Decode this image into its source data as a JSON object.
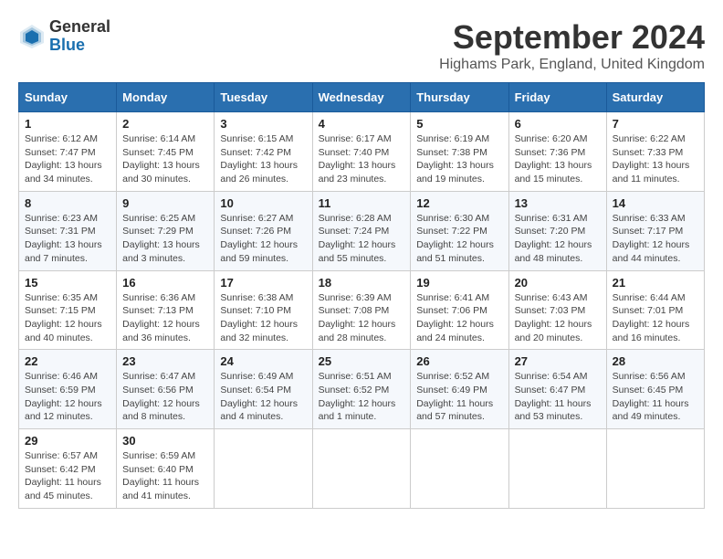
{
  "header": {
    "logo_general": "General",
    "logo_blue": "Blue",
    "month_year": "September 2024",
    "location": "Highams Park, England, United Kingdom"
  },
  "days_of_week": [
    "Sunday",
    "Monday",
    "Tuesday",
    "Wednesday",
    "Thursday",
    "Friday",
    "Saturday"
  ],
  "weeks": [
    [
      {
        "day": "1",
        "info": "Sunrise: 6:12 AM\nSunset: 7:47 PM\nDaylight: 13 hours\nand 34 minutes."
      },
      {
        "day": "2",
        "info": "Sunrise: 6:14 AM\nSunset: 7:45 PM\nDaylight: 13 hours\nand 30 minutes."
      },
      {
        "day": "3",
        "info": "Sunrise: 6:15 AM\nSunset: 7:42 PM\nDaylight: 13 hours\nand 26 minutes."
      },
      {
        "day": "4",
        "info": "Sunrise: 6:17 AM\nSunset: 7:40 PM\nDaylight: 13 hours\nand 23 minutes."
      },
      {
        "day": "5",
        "info": "Sunrise: 6:19 AM\nSunset: 7:38 PM\nDaylight: 13 hours\nand 19 minutes."
      },
      {
        "day": "6",
        "info": "Sunrise: 6:20 AM\nSunset: 7:36 PM\nDaylight: 13 hours\nand 15 minutes."
      },
      {
        "day": "7",
        "info": "Sunrise: 6:22 AM\nSunset: 7:33 PM\nDaylight: 13 hours\nand 11 minutes."
      }
    ],
    [
      {
        "day": "8",
        "info": "Sunrise: 6:23 AM\nSunset: 7:31 PM\nDaylight: 13 hours\nand 7 minutes."
      },
      {
        "day": "9",
        "info": "Sunrise: 6:25 AM\nSunset: 7:29 PM\nDaylight: 13 hours\nand 3 minutes."
      },
      {
        "day": "10",
        "info": "Sunrise: 6:27 AM\nSunset: 7:26 PM\nDaylight: 12 hours\nand 59 minutes."
      },
      {
        "day": "11",
        "info": "Sunrise: 6:28 AM\nSunset: 7:24 PM\nDaylight: 12 hours\nand 55 minutes."
      },
      {
        "day": "12",
        "info": "Sunrise: 6:30 AM\nSunset: 7:22 PM\nDaylight: 12 hours\nand 51 minutes."
      },
      {
        "day": "13",
        "info": "Sunrise: 6:31 AM\nSunset: 7:20 PM\nDaylight: 12 hours\nand 48 minutes."
      },
      {
        "day": "14",
        "info": "Sunrise: 6:33 AM\nSunset: 7:17 PM\nDaylight: 12 hours\nand 44 minutes."
      }
    ],
    [
      {
        "day": "15",
        "info": "Sunrise: 6:35 AM\nSunset: 7:15 PM\nDaylight: 12 hours\nand 40 minutes."
      },
      {
        "day": "16",
        "info": "Sunrise: 6:36 AM\nSunset: 7:13 PM\nDaylight: 12 hours\nand 36 minutes."
      },
      {
        "day": "17",
        "info": "Sunrise: 6:38 AM\nSunset: 7:10 PM\nDaylight: 12 hours\nand 32 minutes."
      },
      {
        "day": "18",
        "info": "Sunrise: 6:39 AM\nSunset: 7:08 PM\nDaylight: 12 hours\nand 28 minutes."
      },
      {
        "day": "19",
        "info": "Sunrise: 6:41 AM\nSunset: 7:06 PM\nDaylight: 12 hours\nand 24 minutes."
      },
      {
        "day": "20",
        "info": "Sunrise: 6:43 AM\nSunset: 7:03 PM\nDaylight: 12 hours\nand 20 minutes."
      },
      {
        "day": "21",
        "info": "Sunrise: 6:44 AM\nSunset: 7:01 PM\nDaylight: 12 hours\nand 16 minutes."
      }
    ],
    [
      {
        "day": "22",
        "info": "Sunrise: 6:46 AM\nSunset: 6:59 PM\nDaylight: 12 hours\nand 12 minutes."
      },
      {
        "day": "23",
        "info": "Sunrise: 6:47 AM\nSunset: 6:56 PM\nDaylight: 12 hours\nand 8 minutes."
      },
      {
        "day": "24",
        "info": "Sunrise: 6:49 AM\nSunset: 6:54 PM\nDaylight: 12 hours\nand 4 minutes."
      },
      {
        "day": "25",
        "info": "Sunrise: 6:51 AM\nSunset: 6:52 PM\nDaylight: 12 hours\nand 1 minute."
      },
      {
        "day": "26",
        "info": "Sunrise: 6:52 AM\nSunset: 6:49 PM\nDaylight: 11 hours\nand 57 minutes."
      },
      {
        "day": "27",
        "info": "Sunrise: 6:54 AM\nSunset: 6:47 PM\nDaylight: 11 hours\nand 53 minutes."
      },
      {
        "day": "28",
        "info": "Sunrise: 6:56 AM\nSunset: 6:45 PM\nDaylight: 11 hours\nand 49 minutes."
      }
    ],
    [
      {
        "day": "29",
        "info": "Sunrise: 6:57 AM\nSunset: 6:42 PM\nDaylight: 11 hours\nand 45 minutes."
      },
      {
        "day": "30",
        "info": "Sunrise: 6:59 AM\nSunset: 6:40 PM\nDaylight: 11 hours\nand 41 minutes."
      },
      null,
      null,
      null,
      null,
      null
    ]
  ]
}
